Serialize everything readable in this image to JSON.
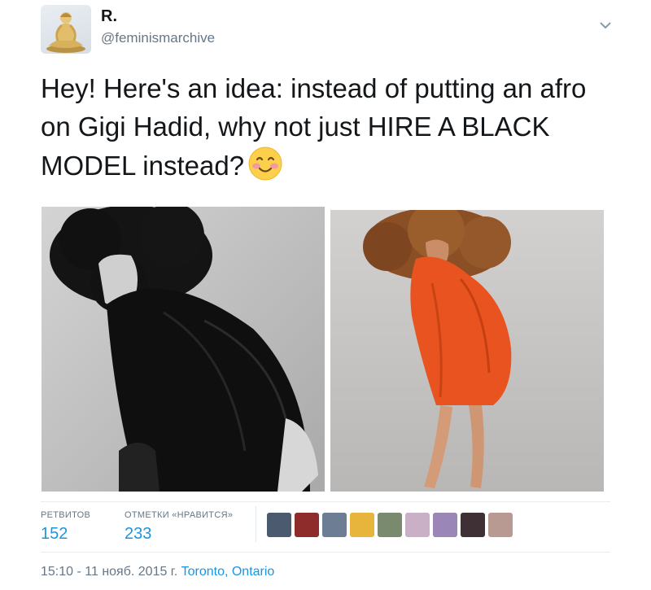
{
  "header": {
    "display_name": "R.",
    "handle": "@feminismarchive"
  },
  "tweet": {
    "text": "Hey! Here's an idea: instead of putting an afro on Gigi Hadid, why not just HIRE A BLACK MODEL instead?",
    "emoji": "smiling-face-with-blushing-cheeks"
  },
  "stats": {
    "retweets_label": "РЕТВИТОВ",
    "retweets_value": "152",
    "likes_label": "ОТМЕТКИ «НРАВИТСЯ»",
    "likes_value": "233"
  },
  "meta": {
    "timestamp": "15:10 - 11 нояб. 2015 г.",
    "location": "Toronto, Ontario"
  },
  "colors": {
    "link_blue": "#1b95e0",
    "secondary_gray": "#657786",
    "text": "#14171a"
  }
}
